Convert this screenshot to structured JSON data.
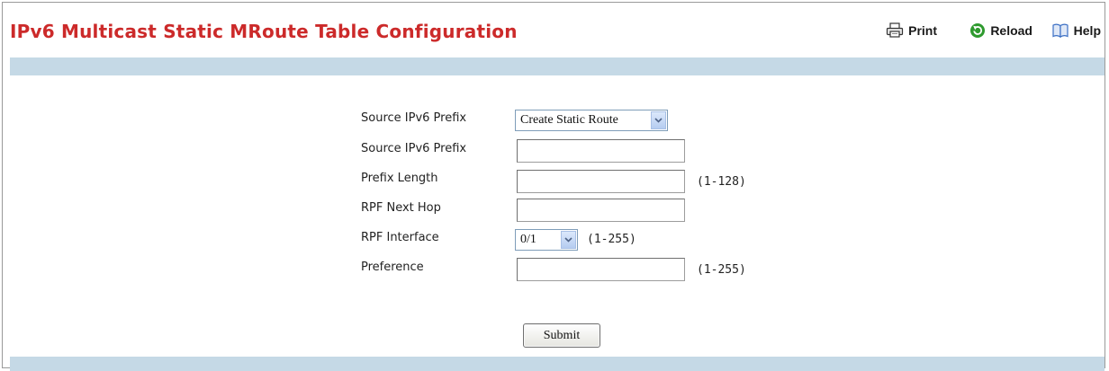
{
  "page": {
    "title": "IPv6 Multicast Static MRoute Table Configuration"
  },
  "toolbar": {
    "print_label": "Print",
    "reload_label": "Reload",
    "help_label": "Help"
  },
  "form": {
    "source_prefix_select": {
      "label": "Source IPv6 Prefix",
      "value": "Create Static Route"
    },
    "source_prefix": {
      "label": "Source IPv6 Prefix",
      "value": ""
    },
    "prefix_length": {
      "label": "Prefix Length",
      "value": "",
      "range": "(1-128)"
    },
    "rpf_next_hop": {
      "label": "RPF Next Hop",
      "value": ""
    },
    "rpf_interface": {
      "label": "RPF Interface",
      "value": "0/1",
      "range": "(1-255)"
    },
    "preference": {
      "label": "Preference",
      "value": "",
      "range": "(1-255)"
    },
    "submit_label": "Submit"
  },
  "colors": {
    "title": "#cc2a2a",
    "band": "#c5d9e6",
    "reload_icon": "#2e9a2e",
    "help_icon": "#3b6fc4",
    "select_border": "#7f9db9"
  },
  "icons": {
    "print": "printer-icon",
    "reload": "reload-icon",
    "help": "help-book-icon",
    "dropdown": "chevron-down-icon"
  }
}
